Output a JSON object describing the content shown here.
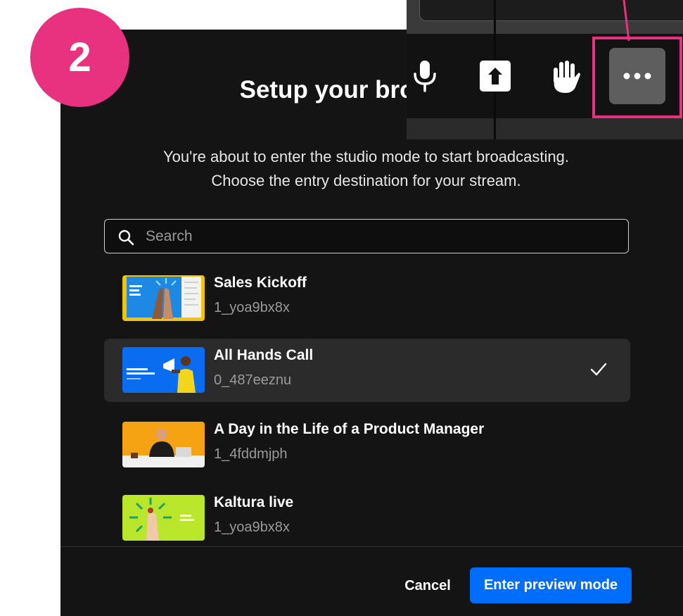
{
  "step": "2",
  "dialog": {
    "title": "Setup your broadcast",
    "description_line1": "You're about to enter the studio mode to start broadcasting.",
    "description_line2": "Choose the entry destination for your stream.",
    "search_placeholder": "Search",
    "entries": [
      {
        "title": "Sales Kickoff",
        "id": "1_yoa9bx8x",
        "selected": false
      },
      {
        "title": "All Hands Call",
        "id": "0_487eeznu",
        "selected": true
      },
      {
        "title": "A Day in the Life of a Product Manager",
        "id": "1_4fddmjph",
        "selected": false
      },
      {
        "title": "Kaltura live",
        "id": "1_yoa9bx8x",
        "selected": false
      }
    ],
    "cancel_label": "Cancel",
    "primary_label": "Enter preview mode"
  },
  "toolbar": {
    "icons": [
      "microphone-icon",
      "share-screen-icon",
      "raise-hand-icon",
      "more-options-icon"
    ]
  },
  "colors": {
    "accent": "#e8317f",
    "primary": "#006efa",
    "modal_bg": "#141414"
  }
}
